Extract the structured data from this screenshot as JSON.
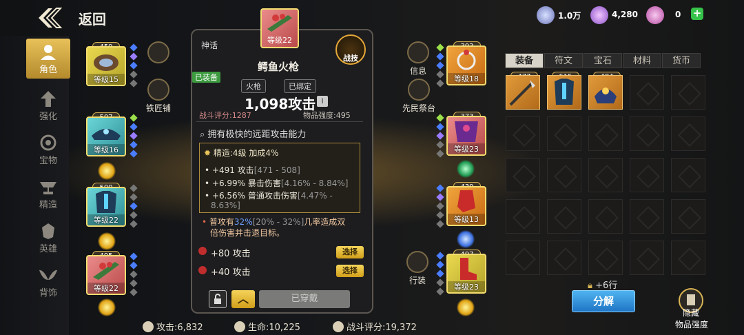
{
  "header": {
    "back_label": "返回"
  },
  "currency": [
    {
      "name": "coin-icon",
      "value": "1.0万"
    },
    {
      "name": "crystal-icon",
      "value": "4,280"
    },
    {
      "name": "gem-icon",
      "value": "0"
    }
  ],
  "nav": [
    {
      "label": "角色"
    },
    {
      "label": "强化"
    },
    {
      "label": "宝物"
    },
    {
      "label": "精造"
    },
    {
      "label": "英雄"
    },
    {
      "label": "背饰"
    }
  ],
  "left_slots": [
    {
      "badge": "459",
      "level": "等级15"
    },
    {
      "badge": "507",
      "level": "等级16"
    },
    {
      "badge": "500",
      "level": "等级22"
    },
    {
      "badge": "495",
      "level": "等级22"
    }
  ],
  "right_slots": [
    {
      "badge": "393",
      "level": "等级18"
    },
    {
      "badge": "373",
      "level": "等级23"
    },
    {
      "badge": "439",
      "level": "等级13"
    },
    {
      "badge": "497",
      "level": "等级23"
    }
  ],
  "side": {
    "blacksmith": "铁匠铺",
    "info": "信息",
    "altar": "先民祭台",
    "outfit": "行装"
  },
  "card": {
    "badge": "495",
    "level": "等级22",
    "rarity": "神话",
    "battle_skill": "战技",
    "name": "鳄鱼火枪",
    "equipped": "已装备",
    "tag1": "火枪",
    "tag2": "已绑定",
    "attack": "1,098攻击",
    "power": "战斗评分:1287",
    "item_strength": "物品强度:495",
    "ability": "拥有极快的远距攻击能力",
    "refine_title": "精造:4级 加成4%",
    "bonus1_main": "+491 攻击",
    "bonus1_range": "[471 - 508]",
    "bonus2_main": "+6.99% 暴击伤害",
    "bonus2_range": "[4.16% - 8.84%]",
    "bonus3_main": "+6.56% 普通攻击伤害",
    "bonus3_range": "[4.47% -",
    "bonus3_range2": "8.63%]",
    "special_a": "普攻有",
    "special_pct": "32%",
    "special_range": "[20% - 32%]",
    "special_b": "几率造成双",
    "special_c": "倍伤害并击退目标。",
    "rune1": "+80 攻击",
    "rune2": "+40 攻击",
    "select": "选择",
    "equipped_btn": "已穿戴"
  },
  "tabs": [
    {
      "label": "装备"
    },
    {
      "label": "符文"
    },
    {
      "label": "宝石"
    },
    {
      "label": "材料"
    },
    {
      "label": "货币"
    }
  ],
  "inventory": [
    {
      "badge": "477"
    },
    {
      "badge": "515"
    },
    {
      "badge": "484"
    }
  ],
  "unlock_rows": "+6行",
  "decompose": "分解",
  "hide_strength": "隐藏",
  "hide_strength2": "物品强度",
  "stats": {
    "attack": "攻击:6,832",
    "hp": "生命:10,225",
    "power": "战斗评分:19,372"
  },
  "colors": {
    "accent": "#d9b553",
    "blue_button": "#1f75c4",
    "highlight": "#6fa0ff"
  }
}
